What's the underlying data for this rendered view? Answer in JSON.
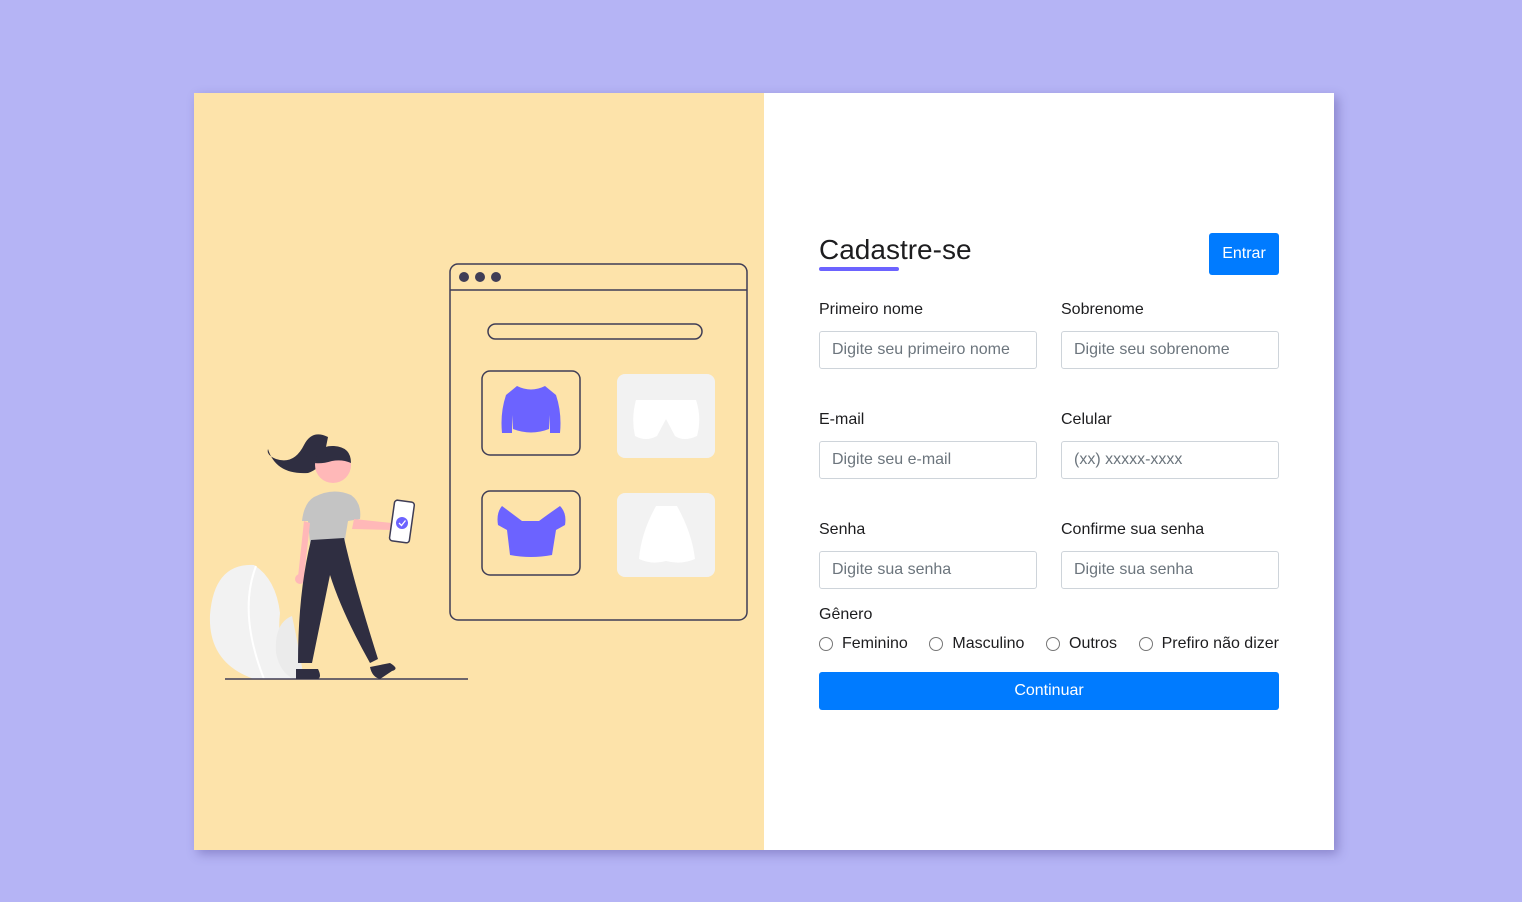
{
  "form": {
    "title": "Cadastre-se",
    "login_label": "Entrar",
    "fields": [
      {
        "label": "Primeiro nome",
        "placeholder": "Digite seu primeiro nome",
        "value": ""
      },
      {
        "label": "Sobrenome",
        "placeholder": "Digite seu sobrenome",
        "value": ""
      },
      {
        "label": "E-mail",
        "placeholder": "Digite seu e-mail",
        "value": ""
      },
      {
        "label": "Celular",
        "placeholder": "(xx) xxxxx-xxxx",
        "value": ""
      },
      {
        "label": "Senha",
        "placeholder": "Digite sua senha",
        "value": ""
      },
      {
        "label": "Confirme sua senha",
        "placeholder": "Digite sua senha",
        "value": ""
      }
    ],
    "gender": {
      "label": "Gênero",
      "options": [
        "Feminino",
        "Masculino",
        "Outros",
        "Prefiro não dizer"
      ],
      "selected": null
    },
    "continue_label": "Continuar"
  },
  "colors": {
    "page_background": "#b5b4f5",
    "illustration_background": "#fde3aa",
    "accent": "#6c63ff",
    "primary_button": "#007bff"
  },
  "illustration": {
    "subject": "shopping-illustration",
    "icons": [
      "browser-window-icon",
      "sweater-icon",
      "shorts-icon",
      "crop-top-icon",
      "skirt-icon",
      "smartphone-icon",
      "checkmark-icon",
      "person-figure",
      "plant-leaf"
    ]
  }
}
